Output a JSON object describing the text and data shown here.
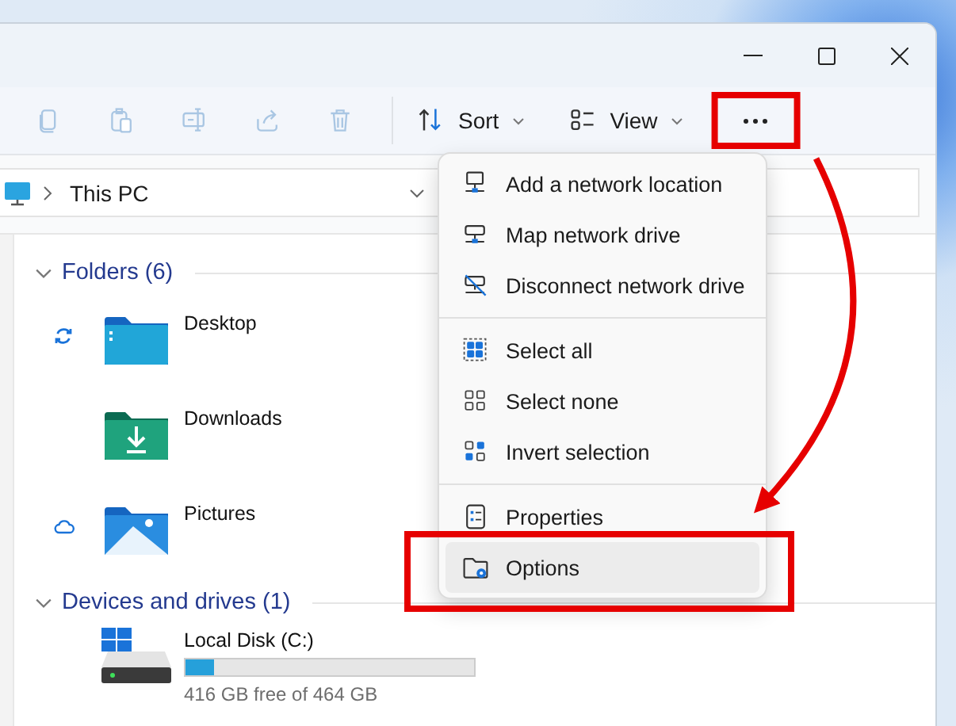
{
  "toolbar": {
    "items": [
      {
        "kind": "copy",
        "disabled": true
      },
      {
        "kind": "paste",
        "disabled": true
      },
      {
        "kind": "rename",
        "disabled": true
      },
      {
        "kind": "share",
        "disabled": true
      },
      {
        "kind": "delete",
        "disabled": true
      },
      {
        "kind": "sort",
        "label": "Sort",
        "disabled": false
      },
      {
        "kind": "view",
        "label": "View",
        "disabled": false
      },
      {
        "kind": "more",
        "disabled": false,
        "annotated": true
      }
    ]
  },
  "address": {
    "path": "This PC"
  },
  "sections": [
    {
      "title": "Folders (6)",
      "expanded": true,
      "items": [
        {
          "kind": "folder",
          "name": "Desktop"
        },
        {
          "kind": "folder",
          "name": "Downloads"
        },
        {
          "kind": "folder",
          "name": "Pictures"
        }
      ]
    },
    {
      "title": "Devices and drives (1)",
      "expanded": true,
      "items": [
        {
          "kind": "drive",
          "name": "Local Disk (C:)",
          "level": 0.1,
          "free": "416 GB free of 464 GB"
        }
      ]
    }
  ],
  "menu": {
    "groups": [
      [
        {
          "label": "Add a network location",
          "selected": false,
          "annotated": false
        },
        {
          "label": "Map network drive",
          "selected": false,
          "annotated": false
        },
        {
          "label": "Disconnect network drive",
          "selected": false,
          "annotated": false
        }
      ],
      [
        {
          "label": "Select all",
          "selected": false,
          "annotated": false
        },
        {
          "label": "Select none",
          "selected": false,
          "annotated": false
        },
        {
          "label": "Invert selection",
          "selected": false,
          "annotated": false
        }
      ],
      [
        {
          "label": "Properties",
          "selected": false,
          "annotated": false
        },
        {
          "label": "Options",
          "selected": true,
          "annotated": true
        }
      ]
    ]
  }
}
